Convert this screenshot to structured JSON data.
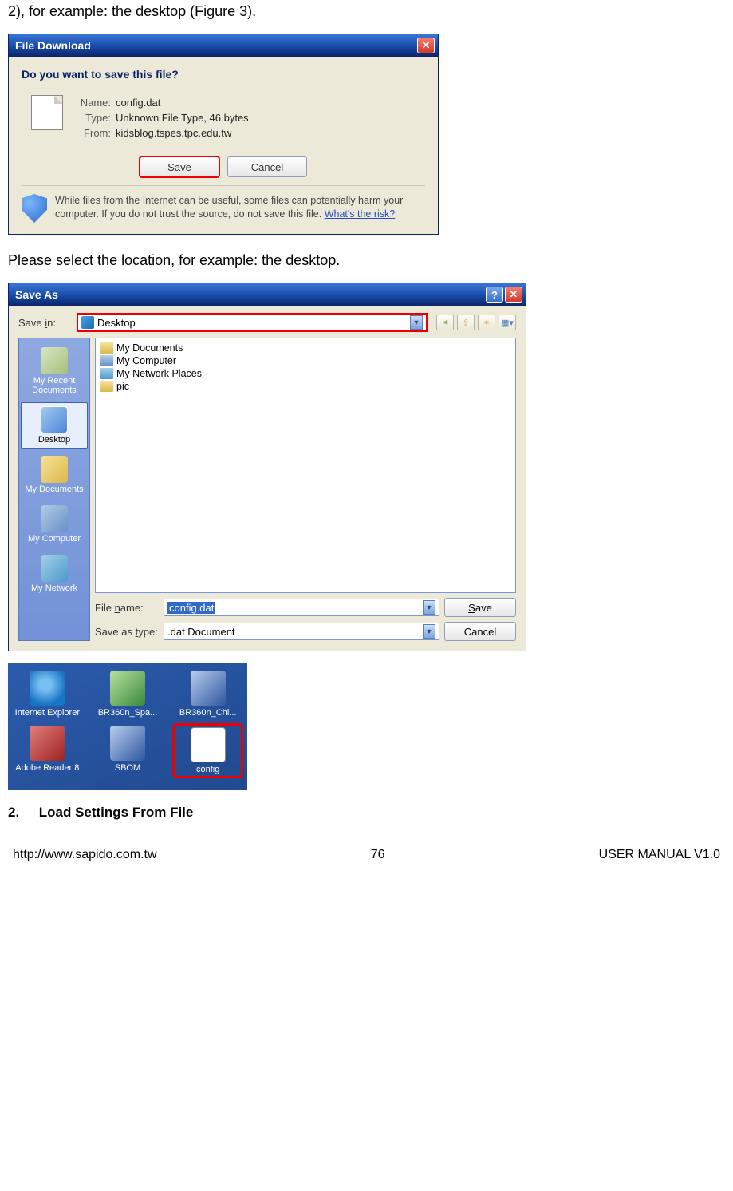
{
  "intro_line": "2), for example: the desktop (Figure 3).",
  "fd": {
    "title": "File Download",
    "question": "Do you want to save this file?",
    "name_label": "Name:",
    "name_value": "config.dat",
    "type_label": "Type:",
    "type_value": "Unknown File Type, 46 bytes",
    "from_label": "From:",
    "from_value": "kidsblog.tspes.tpc.edu.tw",
    "save_btn": "Save",
    "cancel_btn": "Cancel",
    "warning_text": "While files from the Internet can be useful, some files can potentially harm your computer. If you do not trust the source, do not save this file. ",
    "risk_link": "What's the risk?"
  },
  "mid_text": "Please select the location, for example: the desktop.",
  "sa": {
    "title": "Save As",
    "savein_label": "Save in:",
    "savein_value": "Desktop",
    "places": {
      "recent": "My Recent Documents",
      "desktop": "Desktop",
      "docs": "My Documents",
      "computer": "My Computer",
      "network": "My Network"
    },
    "list_items": [
      "My Documents",
      "My Computer",
      "My Network Places",
      "pic"
    ],
    "filename_label": "File name:",
    "filename_value": "config.dat",
    "saveas_label": "Save as type:",
    "saveas_value": ".dat Document",
    "save_btn": "Save",
    "cancel_btn": "Cancel"
  },
  "desktop": {
    "items": [
      "Internet Explorer",
      "BR360n_Spa...",
      "BR360n_Chi...",
      "Adobe Reader 8",
      "SBOM",
      "config"
    ]
  },
  "section": {
    "num": "2.",
    "title": "Load Settings From File"
  },
  "footer": {
    "left": "http://www.sapido.com.tw",
    "center": "76",
    "right": "USER MANUAL V1.0"
  }
}
